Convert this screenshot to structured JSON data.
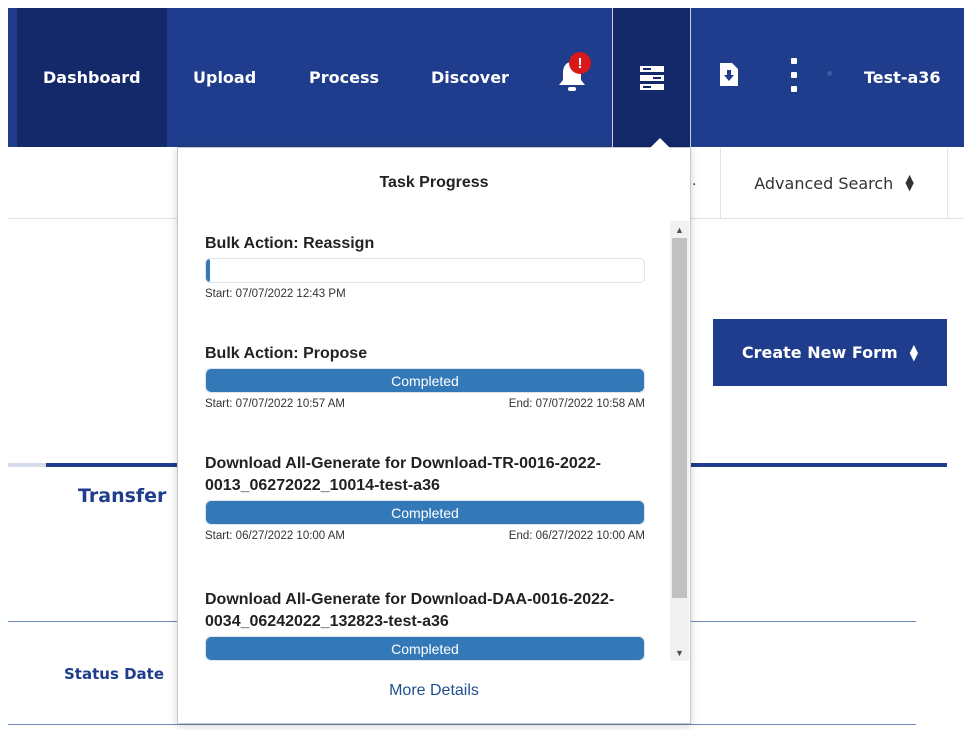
{
  "nav": {
    "items": [
      "Dashboard",
      "Upload",
      "Process",
      "Discover"
    ],
    "badge": "!",
    "user": "Test-a36"
  },
  "page": {
    "advanced_search": "Advanced Search",
    "create_button": "Create New Form",
    "tab_label": "Transfer",
    "column_header": "Status Date",
    "truncated_text": "."
  },
  "popup": {
    "title": "Task Progress",
    "more_details": "More Details",
    "tasks": [
      {
        "name": "Bulk Action: Reassign",
        "progress": 0.01,
        "bar_label": "",
        "start": "Start: 07/07/2022 12:43 PM",
        "end": ""
      },
      {
        "name": "Bulk Action: Propose",
        "progress": 1.0,
        "bar_label": "Completed",
        "start": "Start: 07/07/2022 10:57 AM",
        "end": "End: 07/07/2022 10:58 AM"
      },
      {
        "name": "Download All-Generate for Download-TR-0016-2022-0013_06272022_10014-test-a36",
        "progress": 1.0,
        "bar_label": "Completed",
        "start": "Start: 06/27/2022 10:00 AM",
        "end": "End: 06/27/2022 10:00 AM"
      },
      {
        "name": "Download All-Generate for Download-DAA-0016-2022-0034_06242022_132823-test-a36",
        "progress": 1.0,
        "bar_label": "Completed",
        "start": "",
        "end": ""
      }
    ]
  },
  "icons": [
    "bell-icon",
    "task-list-icon",
    "download-file-icon",
    "more-vertical-icon",
    "sort-icon",
    "scroll-up-icon",
    "scroll-down-icon"
  ],
  "colors": {
    "nav": "#1f3d8c",
    "nav_active": "#13296a",
    "badge": "#d7191c",
    "progress": "#3479b7"
  }
}
